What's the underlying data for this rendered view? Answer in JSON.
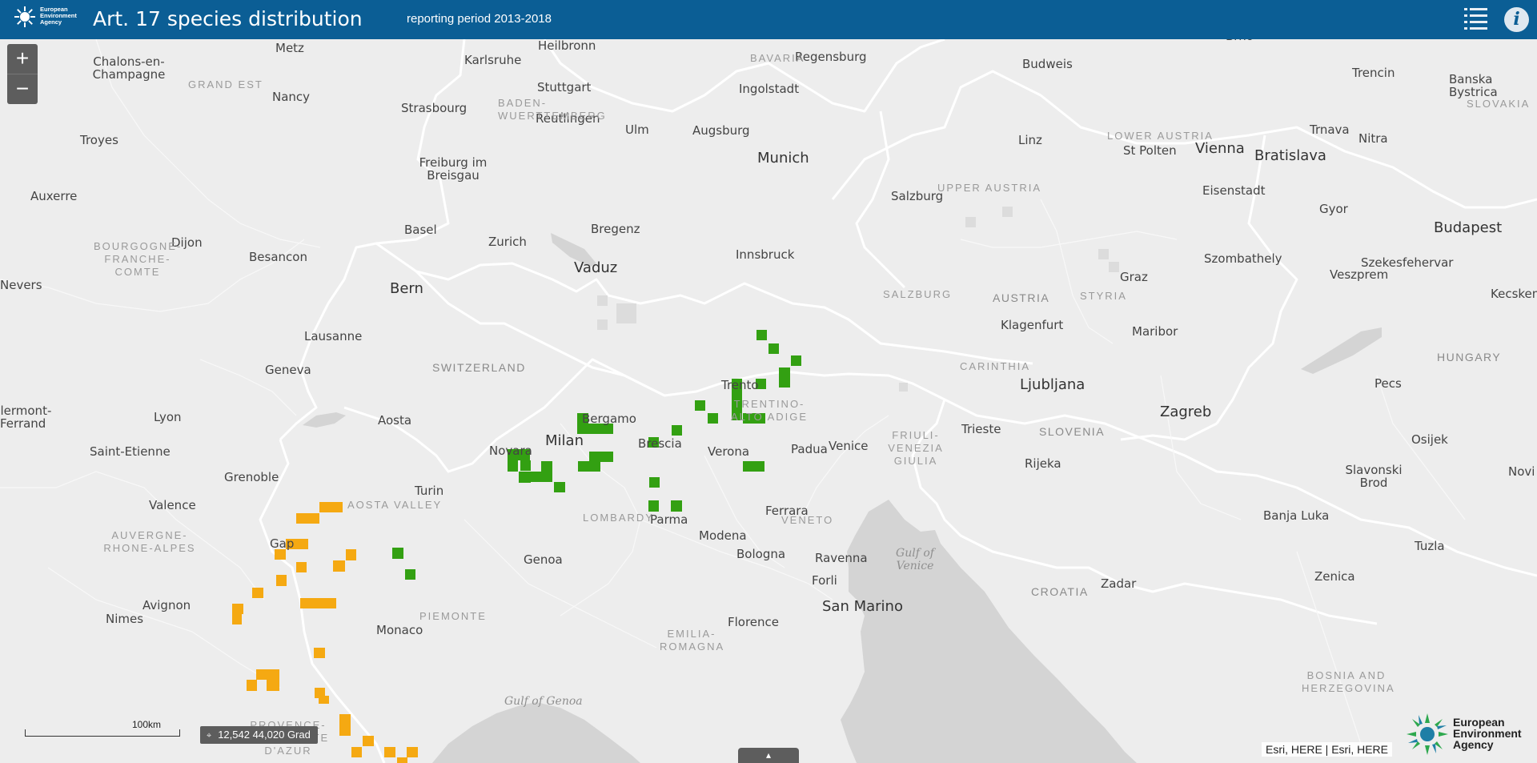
{
  "header": {
    "org_name": "European Environment Agency",
    "title": "Art. 17 species distribution",
    "period": "reporting period 2013-2018",
    "list_icon": "list-icon",
    "info_icon": "info-icon",
    "info_glyph": "i"
  },
  "controls": {
    "zoom_in": "+",
    "zoom_out": "−",
    "scale_label": "100km",
    "coordinates": "12,542 44,020 Grad",
    "coordinates_icon": "crosshair-icon",
    "attribution": "Esri, HERE | Esri, HERE",
    "footer_logo": "European Environment Agency",
    "bottom_tab_icon": "chevron-up-icon"
  },
  "map": {
    "cities": [
      "Metz",
      "Heilbronn",
      "Regensburg",
      "Karlsruhe",
      "Chalons-en-Champagne",
      "Stuttgart",
      "Ingolstadt",
      "Budweis",
      "Trencin",
      "Banska Bystrica",
      "Nancy",
      "Strasbourg",
      "Reutlingen",
      "Ulm",
      "Augsburg",
      "Troyes",
      "Munich",
      "Linz",
      "St Polten",
      "Vienna",
      "Bratislava",
      "Trnava",
      "Nitra",
      "Freiburg im Breisgau",
      "Auxerre",
      "Salzburg",
      "Eisenstadt",
      "Basel",
      "Bregenz",
      "Zurich",
      "Gyor",
      "Budapest",
      "Dijon",
      "Innsbruck",
      "Besancon",
      "Szombathely",
      "Vaduz",
      "Szekesfehervar",
      "Veszprem",
      "Nevers",
      "Bern",
      "Graz",
      "Kecskem",
      "Lausanne",
      "Klagenfurt",
      "Maribor",
      "Geneva",
      "Trento",
      "Ljubljana",
      "Pecs",
      "Aosta",
      "Bergamo",
      "Brescia",
      "Zagreb",
      "Lyon",
      "Milan",
      "Verona",
      "Padua",
      "Venice",
      "Trieste",
      "Saint-Etienne",
      "Novara",
      "Osijek",
      "Grenoble",
      "Turin",
      "Rijeka",
      "Slavonski Brod",
      "Valence",
      "Novi",
      "Parma",
      "Ferrara",
      "Banja Luka",
      "Modena",
      "Gap",
      "Bologna",
      "Tuzla",
      "Genoa",
      "Ravenna",
      "Forli",
      "Zenica",
      "Zadar",
      "Avignon",
      "San Marino",
      "Nimes",
      "Monaco",
      "Florence",
      "Clermont-Ferrand",
      "Brno"
    ],
    "regions": [
      "GRAND EST",
      "BADEN-WUERTTEMBERG",
      "BAVARIA",
      "LOWER AUSTRIA",
      "UPPER AUSTRIA",
      "BOURGOGNE-FRANCHE-COMTE",
      "SALZBURG",
      "STYRIA",
      "TRENTINO-ALTO ADIGE",
      "CARINTHIA",
      "FRIULI-VENEZIA GIULIA",
      "AUVERGNE-RHONE-ALPES",
      "AOSTA VALLEY",
      "LOMBARDY",
      "VENETO",
      "PIEMONTE",
      "EMILIA-ROMAGNA",
      "PROVENCE-ALPES-COTE D'AZUR",
      "BOSNIA AND HERZEGOVINA",
      "SLOVAKIA"
    ],
    "countries": [
      "SWITZERLAND",
      "AUSTRIA",
      "SLOVENIA",
      "HUNGARY",
      "CROATIA"
    ],
    "seas": [
      "Gulf of Venice",
      "Gulf of Genoa"
    ],
    "colors": {
      "land": "#ededed",
      "sea": "#d4d4d4",
      "border": "#ffffff",
      "green": "#33a012",
      "orange": "#f5a912",
      "grey": "#dcdcdc"
    }
  }
}
